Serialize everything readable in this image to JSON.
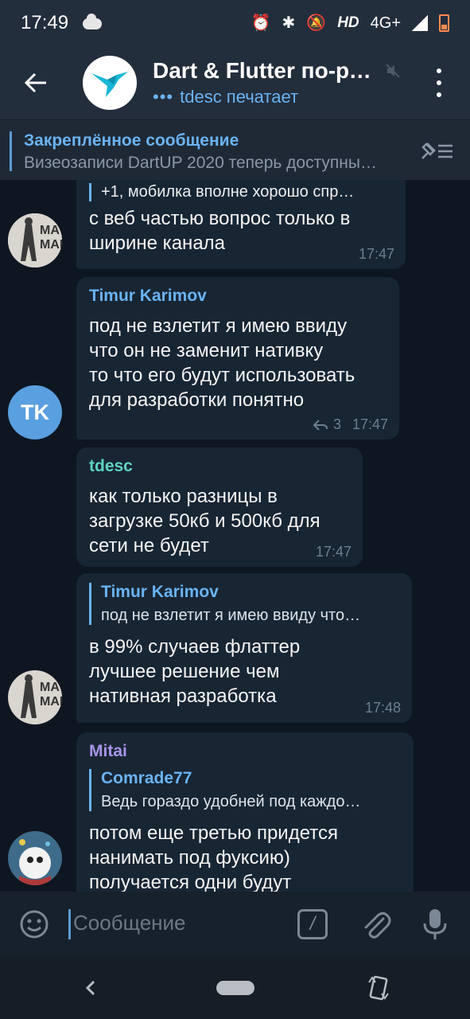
{
  "status_bar": {
    "time": "17:49",
    "network_label": "HD",
    "network_type": "4G+"
  },
  "header": {
    "back_icon": "arrow-left-icon",
    "title": "Dart & Flutter по-ру…",
    "typing_dots": "•••",
    "typing_text": "tdesc печатает",
    "muted": true
  },
  "pinned": {
    "title": "Закреплённое сообщение",
    "text": "Визеозаписи DartUP 2020 теперь доступны…"
  },
  "messages": [
    {
      "reply_text": "+1, мобилка вполне хорошо спр…",
      "text": "с веб частью вопрос только в\nширине канала",
      "time": "17:47"
    },
    {
      "sender": "Timur Karimov",
      "sender_color": "#6ab3f3",
      "avatar_initials": "TK",
      "text": "под не взлетит я имею ввиду\nчто он не заменит нативку\nто что его будут использовать\nдля разработки понятно",
      "replies_count": "3",
      "time": "17:47"
    },
    {
      "sender": "tdesc",
      "sender_color": "#5fd3c4",
      "text": "как только разницы в\nзагрузке 50кб и 500кб для\nсети не будет",
      "time": "17:47"
    },
    {
      "reply_name": "Timur Karimov",
      "reply_text": "под не взлетит я имею ввиду что…",
      "text": "в 99% случаев флаттер\nлучшее решение чем\nнативная разработка",
      "time": "17:48"
    },
    {
      "sender": "Mitai",
      "sender_color": "#a695e7",
      "reply_name": "Comrade77",
      "reply_text": "Ведь гораздо удобней под каждо…",
      "text": "потом еще третью придется\nнанимать под фуксию)\nполучается одни будут"
    }
  ],
  "input": {
    "placeholder": "Сообщение",
    "command_glyph": "/"
  },
  "colors": {
    "accent": "#6ab3f3",
    "bubble": "#182533",
    "background": "#0e1621",
    "header": "#232e3c"
  }
}
